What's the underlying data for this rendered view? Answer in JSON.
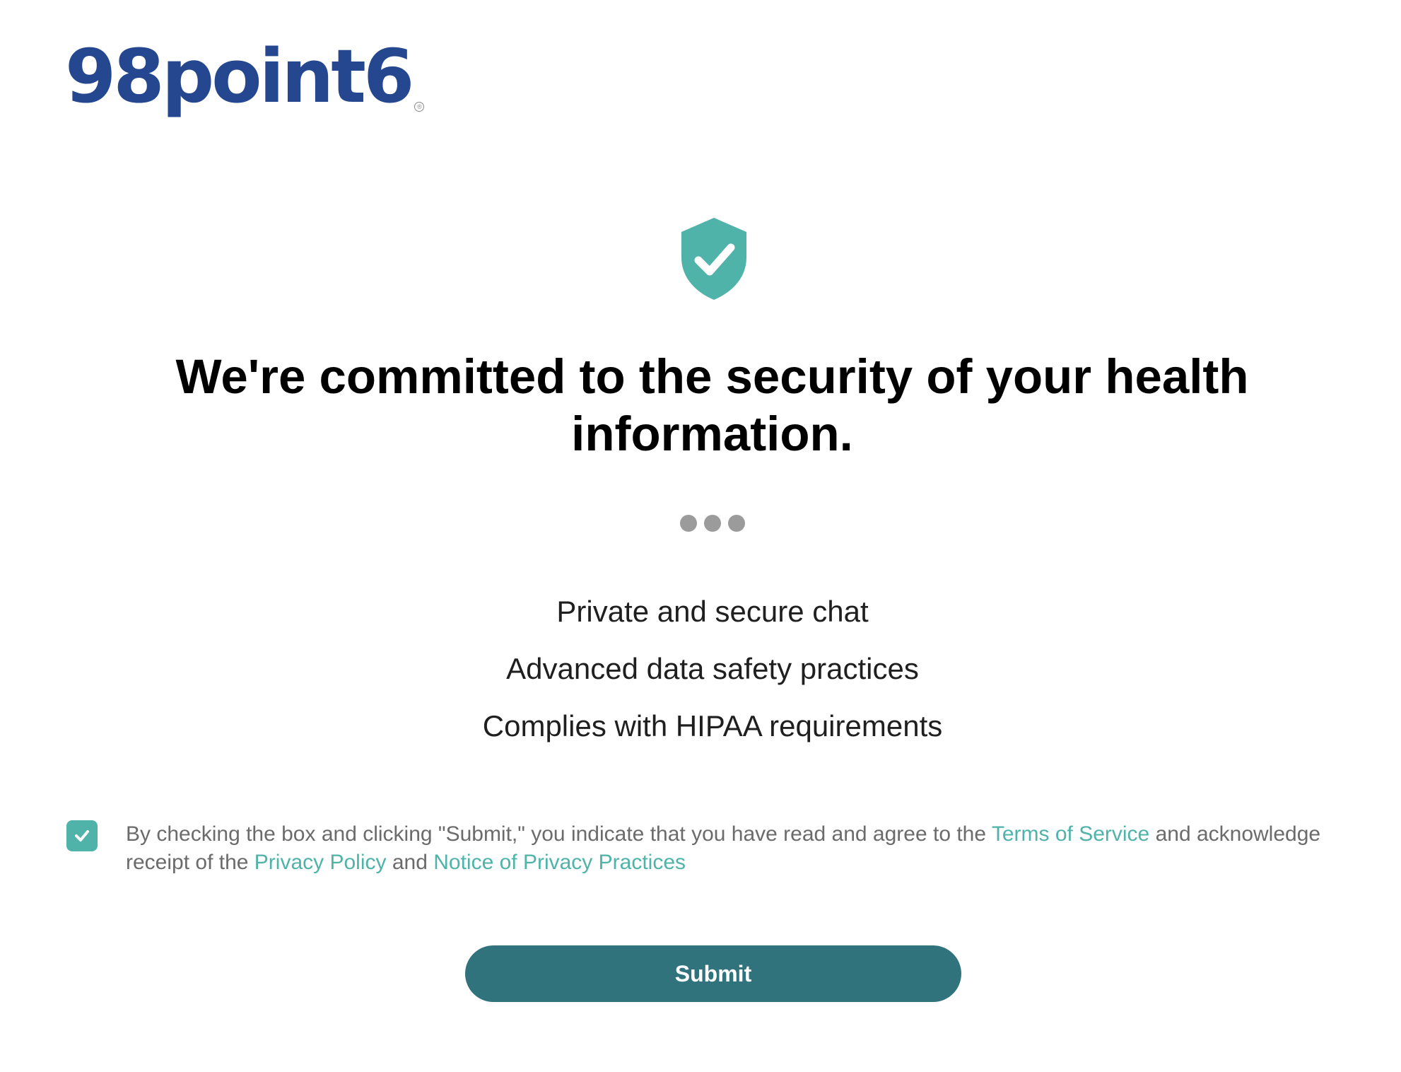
{
  "brand": {
    "logo_text": "98point6",
    "registered_mark": "®",
    "primary_color": "#24478f",
    "accent_color": "#4fb3a9"
  },
  "hero": {
    "icon": "shield-check-icon",
    "headline": "We're committed to the security of your health information."
  },
  "progress": {
    "dot_count": 3,
    "dot_color": "#9b9b9b"
  },
  "features": [
    "Private and secure chat",
    "Advanced data safety practices",
    "Complies with HIPAA requirements"
  ],
  "consent": {
    "checked": true,
    "text_before_terms": "By checking the box and clicking \"Submit,\" you indicate that you have read and agree to the ",
    "terms_link": "Terms of Service",
    "text_after_terms": " and acknowledge receipt of the ",
    "privacy_link": "Privacy Policy",
    "text_and": " and ",
    "notice_link": "Notice of Privacy Practices"
  },
  "actions": {
    "submit_label": "Submit",
    "submit_color": "#31737d"
  }
}
